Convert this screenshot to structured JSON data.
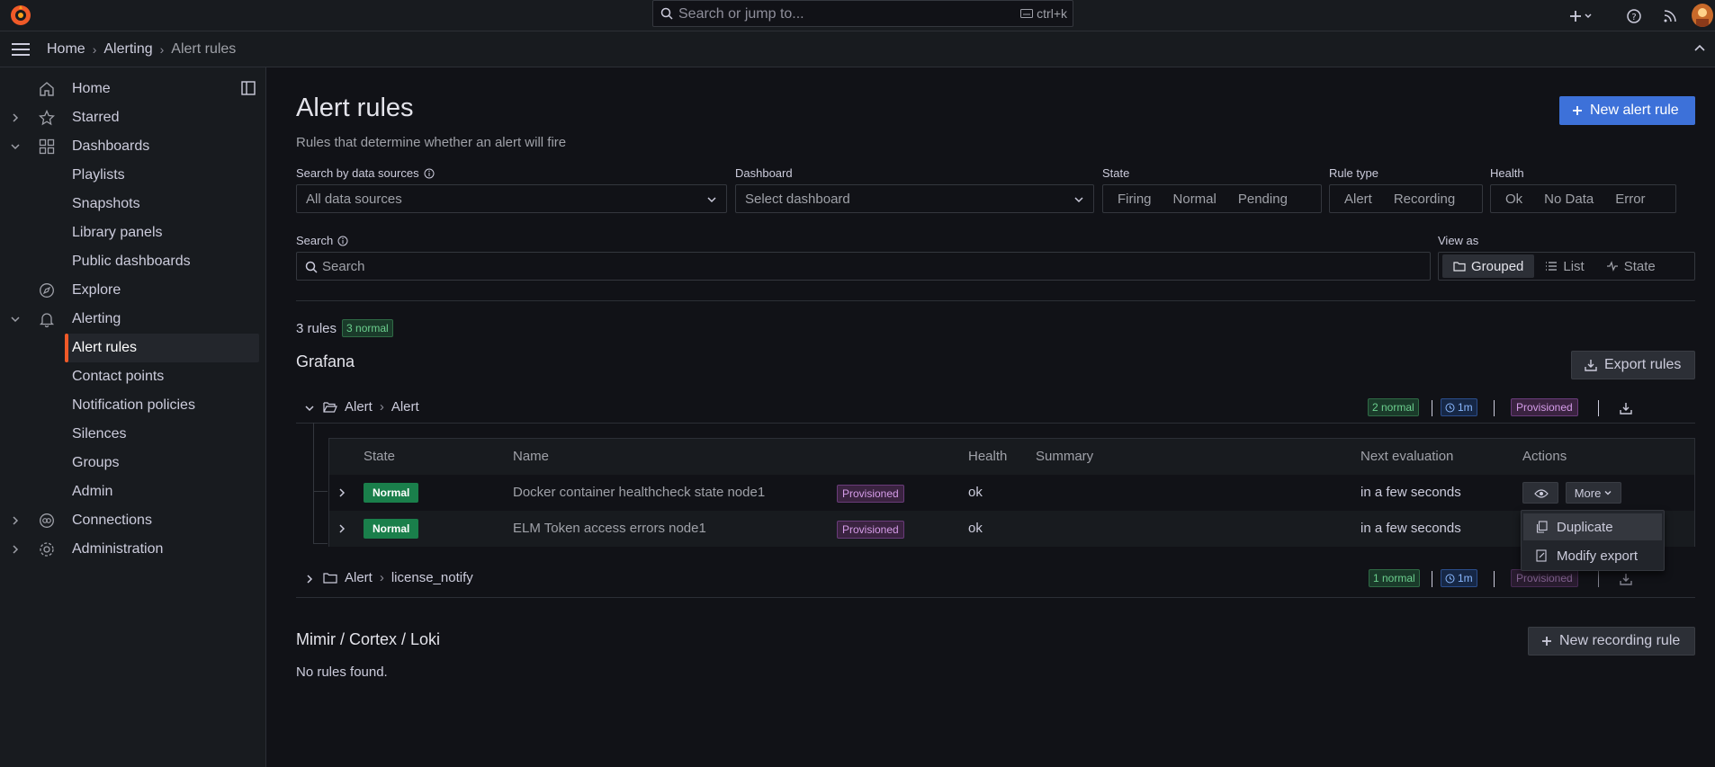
{
  "topbar": {
    "search_placeholder": "Search or jump to...",
    "search_shortcut": "ctrl+k"
  },
  "breadcrumb": [
    "Home",
    "Alerting",
    "Alert rules"
  ],
  "sidebar": {
    "items": [
      {
        "label": "Home",
        "icon": "home-icon"
      },
      {
        "label": "Starred",
        "icon": "star-icon"
      },
      {
        "label": "Dashboards",
        "icon": "apps-icon"
      },
      {
        "label": "Playlists"
      },
      {
        "label": "Snapshots"
      },
      {
        "label": "Library panels"
      },
      {
        "label": "Public dashboards"
      },
      {
        "label": "Explore",
        "icon": "compass-icon"
      },
      {
        "label": "Alerting",
        "icon": "bell-icon"
      },
      {
        "label": "Alert rules"
      },
      {
        "label": "Contact points"
      },
      {
        "label": "Notification policies"
      },
      {
        "label": "Silences"
      },
      {
        "label": "Groups"
      },
      {
        "label": "Admin"
      },
      {
        "label": "Connections",
        "icon": "connections-icon"
      },
      {
        "label": "Administration",
        "icon": "cog-icon"
      }
    ]
  },
  "page": {
    "title": "Alert rules",
    "subtitle": "Rules that determine whether an alert will fire",
    "new_rule_label": "New alert rule"
  },
  "filters": {
    "datasource_label": "Search by data sources",
    "datasource_value": "All data sources",
    "dashboard_label": "Dashboard",
    "dashboard_value": "Select dashboard",
    "state_label": "State",
    "state_options": [
      "Firing",
      "Normal",
      "Pending"
    ],
    "ruletype_label": "Rule type",
    "ruletype_options": [
      "Alert",
      "Recording"
    ],
    "health_label": "Health",
    "health_options": [
      "Ok",
      "No Data",
      "Error"
    ],
    "search_label": "Search",
    "search_placeholder": "Search",
    "viewas_label": "View as",
    "viewas_options": [
      "Grouped",
      "List",
      "State"
    ],
    "viewas_selected": "Grouped"
  },
  "summary": {
    "count_text": "3 rules",
    "normal_badge": "3 normal"
  },
  "grafana": {
    "title": "Grafana",
    "export_label": "Export rules",
    "groups": [
      {
        "folder": "Alert",
        "name": "Alert",
        "normal_badge": "2 normal",
        "interval": "1m",
        "provisioned": "Provisioned"
      },
      {
        "folder": "Alert",
        "name": "license_notify",
        "normal_badge": "1 normal",
        "interval": "1m",
        "provisioned": "Provisioned"
      }
    ]
  },
  "table": {
    "headers": [
      "State",
      "Name",
      "Health",
      "Summary",
      "Next evaluation",
      "Actions"
    ],
    "rows": [
      {
        "state": "Normal",
        "name": "Docker container healthcheck state node1",
        "badge": "Provisioned",
        "health": "ok",
        "summary": "",
        "next": "in a few seconds"
      },
      {
        "state": "Normal",
        "name": "ELM Token access errors node1",
        "badge": "Provisioned",
        "health": "ok",
        "summary": "",
        "next": "in a few seconds"
      }
    ],
    "more_label": "More"
  },
  "dropdown": {
    "items": [
      "Duplicate",
      "Modify export"
    ]
  },
  "mimir": {
    "title": "Mimir / Cortex / Loki",
    "new_recording_label": "New recording rule",
    "empty_text": "No rules found."
  },
  "colors": {
    "accent": "#3d71d9",
    "brand": "#f05a28",
    "normal_state": "#1a7f4b",
    "provisioned": "#d59ce8"
  }
}
